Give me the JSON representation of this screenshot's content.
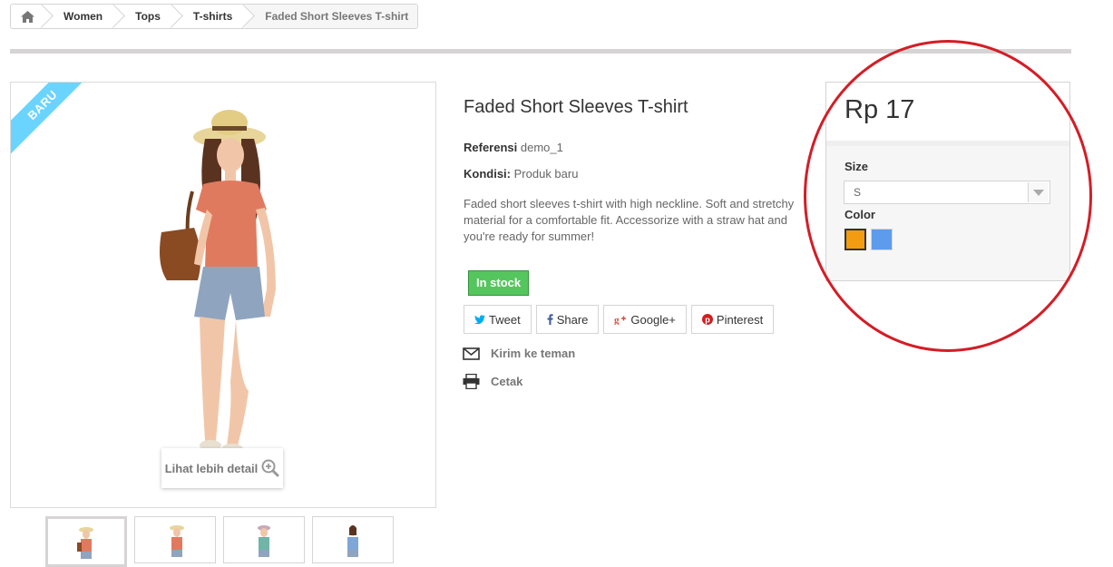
{
  "breadcrumb": {
    "home_icon": "home-icon",
    "items": [
      "Women",
      "Tops",
      "T-shirts"
    ],
    "current": "Faded Short Sleeves T-shirt"
  },
  "image": {
    "badge": "BARU",
    "zoom_label": "Lihat lebih detail",
    "zoom_icon": "zoom-in-icon"
  },
  "product": {
    "title": "Faded Short Sleeves T-shirt",
    "reference_label": "Referensi",
    "reference_value": "demo_1",
    "condition_label": "Kondisi:",
    "condition_value": "Produk baru",
    "description": "Faded short sleeves t-shirt with high neckline. Soft and stretchy material for a comfortable fit. Accessorize with a straw hat and you're ready for summer!",
    "stock": "In stock"
  },
  "social": {
    "tweet": "Tweet",
    "share": "Share",
    "googleplus": "Google+",
    "pinterest": "Pinterest"
  },
  "links": {
    "send_friend": "Kirim ke teman",
    "print": "Cetak"
  },
  "buy_box": {
    "price": "Rp 17",
    "size_label": "Size",
    "size_value": "S",
    "color_label": "Color",
    "colors": [
      "#f39c11",
      "#5d9cec"
    ]
  },
  "colors": {
    "accent_circle": "#d41d26",
    "badge": "#6ad4ff",
    "stock_green": "#55c65e"
  }
}
